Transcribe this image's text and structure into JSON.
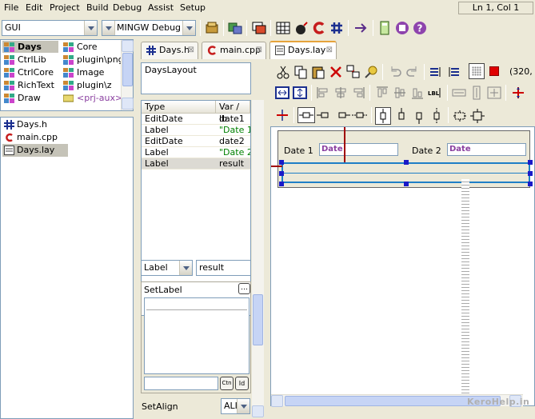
{
  "menu": [
    "File",
    "Edit",
    "Project",
    "Build",
    "Debug",
    "Assist",
    "Setup"
  ],
  "status": {
    "position": "Ln 1, Col 1"
  },
  "toolbar": {
    "package_combo": "GUI",
    "build_combo": "MINGW Debug"
  },
  "packages": {
    "col1": [
      "Days",
      "CtrlLib",
      "CtrlCore",
      "RichText",
      "Draw"
    ],
    "col2": [
      "Core",
      "plugin\\png",
      "Image",
      "plugin\\z",
      "<prj-aux>"
    ]
  },
  "files": [
    "Days.h",
    "main.cpp",
    "Days.lay"
  ],
  "tabs": [
    {
      "label": "Days.h",
      "icon": "hash-icon"
    },
    {
      "label": "main.cpp",
      "icon": "cpp-icon"
    },
    {
      "label": "Days.lay",
      "icon": "layout-icon"
    }
  ],
  "layout_list": [
    "DaysLayout"
  ],
  "props": {
    "headers": [
      "Type",
      "Var / lb"
    ],
    "rows": [
      {
        "type": "EditDate",
        "var": "date1",
        "is_label": false
      },
      {
        "type": "Label",
        "var": "\"Date 1\"",
        "is_label": true
      },
      {
        "type": "EditDate",
        "var": "date2",
        "is_label": false
      },
      {
        "type": "Label",
        "var": "\"Date 2\"",
        "is_label": true
      },
      {
        "type": "Label",
        "var": "result",
        "is_label": false
      }
    ]
  },
  "editor": {
    "type_value": "Label",
    "var_value": "result",
    "set_label": "SetLabel",
    "ctn_btn": "Ctn",
    "id_btn": "Id",
    "set_align": "SetAlign",
    "align_value": "ALI"
  },
  "coord_readout": "(320,",
  "design": {
    "label1": "Date 1",
    "field1": "Date",
    "label2": "Date 2",
    "field2": "Date"
  },
  "watermark": "KeroHelp.in",
  "colors": {
    "accent_tab": "#e6a33b",
    "selection_handles": "#1a1ac8",
    "label_string_green": "#008000",
    "date_field_purple": "#8a3fa0"
  }
}
